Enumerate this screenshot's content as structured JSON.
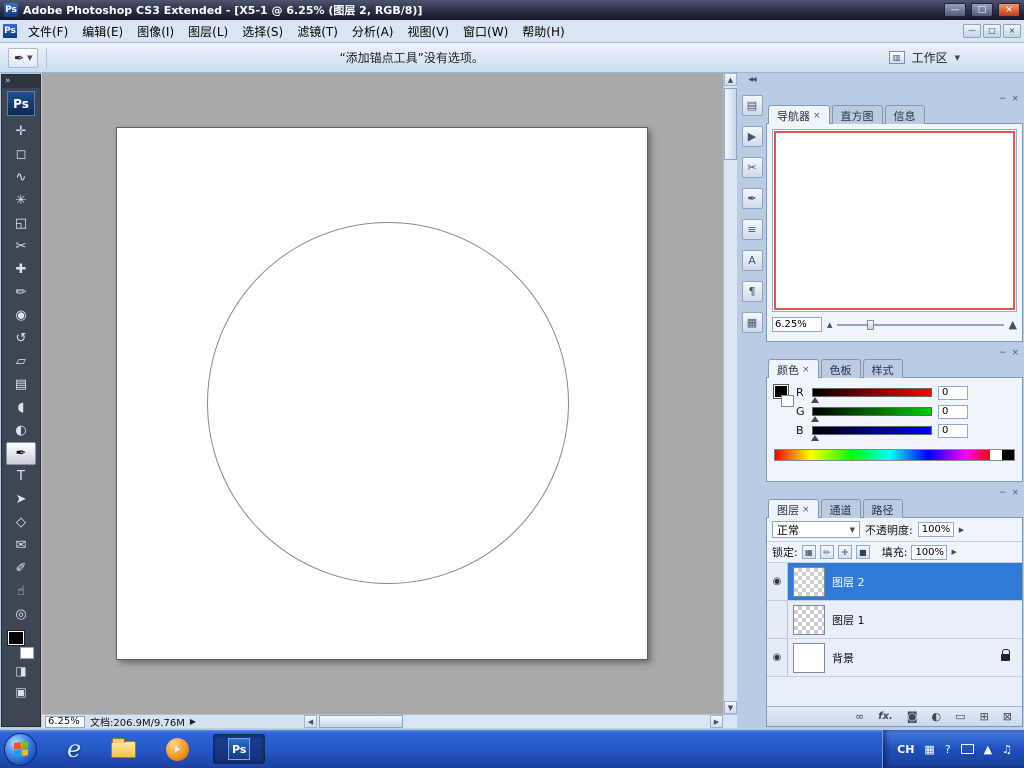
{
  "colors": {
    "taskbar_blue": "#2456c4",
    "selection_blue": "#3079d6",
    "navigator_view_border": "#e05a52",
    "foreground_color": "#000000",
    "background_color": "#ffffff",
    "canvas_gray": "#a9a9a9"
  },
  "glyphs": {
    "dropdown": "▼",
    "spinner": "▶",
    "minimize": "−",
    "close": "×",
    "maximize": "□",
    "titlebar_minimize": "—",
    "eye": "◉",
    "collapse_left": "◀◀",
    "collapse_right": "»",
    "scroll_up": "▲",
    "scroll_down": "▼",
    "scroll_left": "◀",
    "scroll_right": "▶"
  },
  "window": {
    "logo_text": "Ps",
    "title": "Adobe Photoshop CS3 Extended - [X5-1 @ 6.25% (图层 2, RGB/8)]"
  },
  "menubar": {
    "items": [
      "文件(F)",
      "编辑(E)",
      "图像(I)",
      "图层(L)",
      "选择(S)",
      "滤镜(T)",
      "分析(A)",
      "视图(V)",
      "窗口(W)",
      "帮助(H)"
    ]
  },
  "options": {
    "tool_icon": "✒",
    "message": "“添加锚点工具”没有选项。",
    "workspace_icon": "▥",
    "workspace_label": "工作区"
  },
  "toolbox": {
    "logo": "Ps",
    "tools": [
      {
        "name": "move-tool",
        "glyph": "✛"
      },
      {
        "name": "rectangular-marquee-tool",
        "glyph": "◻"
      },
      {
        "name": "lasso-tool",
        "glyph": "∿"
      },
      {
        "name": "quick-selection-tool",
        "glyph": "✳"
      },
      {
        "name": "crop-tool",
        "glyph": "◱"
      },
      {
        "name": "slice-tool",
        "glyph": "✂"
      },
      {
        "name": "healing-brush-tool",
        "glyph": "✚"
      },
      {
        "name": "brush-tool",
        "glyph": "✏"
      },
      {
        "name": "clone-stamp-tool",
        "glyph": "◉"
      },
      {
        "name": "history-brush-tool",
        "glyph": "↺"
      },
      {
        "name": "eraser-tool",
        "glyph": "▱"
      },
      {
        "name": "gradient-tool",
        "glyph": "▤"
      },
      {
        "name": "blur-tool",
        "glyph": "◖"
      },
      {
        "name": "dodge-tool",
        "glyph": "◐"
      },
      {
        "name": "pen-tool",
        "glyph": "✒",
        "active": true
      },
      {
        "name": "type-tool",
        "glyph": "T"
      },
      {
        "name": "path-selection-tool",
        "glyph": "➤"
      },
      {
        "name": "shape-tool",
        "glyph": "◇"
      },
      {
        "name": "notes-tool",
        "glyph": "✉"
      },
      {
        "name": "eyedropper-tool",
        "glyph": "✐"
      },
      {
        "name": "hand-tool",
        "glyph": "☝"
      },
      {
        "name": "zoom-tool",
        "glyph": "◎"
      }
    ],
    "quick_mask": "◨",
    "screen_mode": "▣"
  },
  "dock": {
    "icons": [
      {
        "name": "brushes-panel",
        "glyph": "▤"
      },
      {
        "name": "clone-source-panel",
        "glyph": "▶"
      },
      {
        "name": "tool-presets-panel",
        "glyph": "✂"
      },
      {
        "name": "styles-panel",
        "glyph": "✒"
      },
      {
        "name": "layer-comps-panel",
        "glyph": "≡"
      },
      {
        "name": "character-panel",
        "glyph": "A"
      },
      {
        "name": "paragraph-panel",
        "glyph": "¶"
      },
      {
        "name": "histogram-panel",
        "glyph": "▦"
      }
    ]
  },
  "navigator": {
    "tabs": [
      "导航器",
      "直方图",
      "信息"
    ],
    "zoom_value": "6.25%",
    "zoom_out_icon": "▲",
    "zoom_in_icon": "▲"
  },
  "color": {
    "tabs": [
      "颜色",
      "色板",
      "样式"
    ],
    "channels": [
      {
        "label": "R",
        "value": "0"
      },
      {
        "label": "G",
        "value": "0"
      },
      {
        "label": "B",
        "value": "0"
      }
    ]
  },
  "layers": {
    "tabs": [
      "图层",
      "通道",
      "路径"
    ],
    "blend_mode": "正常",
    "opacity_label": "不透明度:",
    "opacity_value": "100%",
    "lock_label": "锁定:",
    "lock_icons": [
      {
        "name": "lock-transparency",
        "glyph": "▦"
      },
      {
        "name": "lock-pixels",
        "glyph": "✏"
      },
      {
        "name": "lock-position",
        "glyph": "✛"
      },
      {
        "name": "lock-all",
        "glyph": "■"
      }
    ],
    "fill_label": "填充:",
    "fill_value": "100%",
    "rows": [
      {
        "name": "图层 2",
        "visible": true,
        "selected": true,
        "thumb": "transparent"
      },
      {
        "name": "图层 1",
        "visible": false,
        "selected": false,
        "thumb": "transparent"
      },
      {
        "name": "背景",
        "visible": true,
        "selected": false,
        "locked": true,
        "thumb": "white"
      }
    ],
    "footer_icons": [
      {
        "name": "link-layers",
        "glyph": "∞"
      },
      {
        "name": "layer-style",
        "glyph": "fx."
      },
      {
        "name": "add-layer-mask",
        "glyph": "◙"
      },
      {
        "name": "new-adjustment-layer",
        "glyph": "◐"
      },
      {
        "name": "new-group",
        "glyph": "▭"
      },
      {
        "name": "new-layer",
        "glyph": "⊞"
      },
      {
        "name": "delete-layer",
        "glyph": "⊠"
      }
    ]
  },
  "statusbar": {
    "zoom": "6.25%",
    "doc_label": "文档:206.9M/9.76M"
  },
  "taskbar": {
    "apps": [
      {
        "name": "internet-explorer",
        "glyph": "e"
      },
      {
        "name": "file-explorer",
        "glyph": ""
      },
      {
        "name": "media-player",
        "glyph": "▸"
      },
      {
        "name": "photoshop",
        "glyph": "Ps",
        "active": true
      }
    ],
    "tray": {
      "lang": "CH",
      "icons": [
        {
          "name": "keyboard-indicator",
          "glyph": "▦"
        },
        {
          "name": "help-icon",
          "glyph": "?"
        },
        {
          "name": "show-hidden-icons",
          "glyph": "▲"
        },
        {
          "name": "volume-icon",
          "glyph": "♫"
        }
      ]
    }
  }
}
